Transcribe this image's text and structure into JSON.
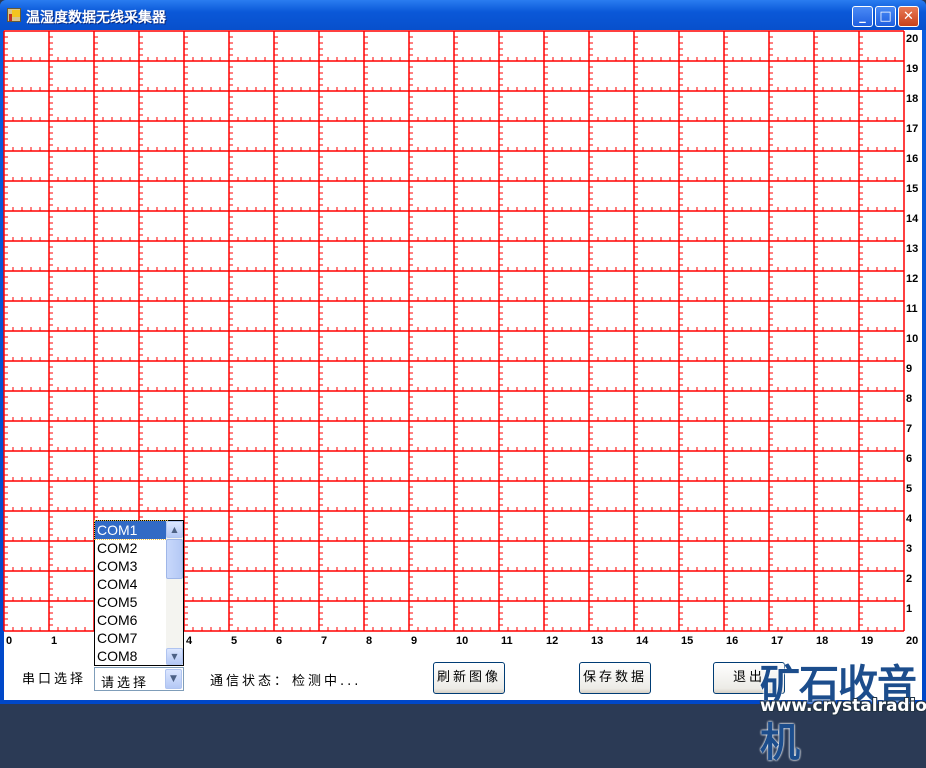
{
  "window": {
    "title": "温湿度数据无线采集器",
    "minimize": "_",
    "maximize": "□",
    "close": "✕"
  },
  "plot": {
    "x_ticks": [
      "0",
      "1",
      "2",
      "3",
      "4",
      "5",
      "6",
      "7",
      "8",
      "9",
      "10",
      "11",
      "12",
      "13",
      "14",
      "15",
      "16",
      "17",
      "18",
      "19",
      "20"
    ],
    "y_ticks": [
      "1",
      "2",
      "3",
      "4",
      "5",
      "6",
      "7",
      "8",
      "9",
      "10",
      "11",
      "12",
      "13",
      "14",
      "15",
      "16",
      "17",
      "18",
      "19",
      "20"
    ],
    "grid_color": "#ff0000"
  },
  "controls": {
    "port_label": "串口选择",
    "port_combo_value": "请选择",
    "port_options": [
      "COM1",
      "COM2",
      "COM3",
      "COM4",
      "COM5",
      "COM6",
      "COM7",
      "COM8"
    ],
    "status_label": "通信状态：",
    "status_value": "检测中...",
    "refresh_button": "刷新图像",
    "save_button": "保存数据",
    "exit_button": "退出"
  },
  "watermark": {
    "text": "矿石收音机",
    "url": "www.crystalradio.cn"
  }
}
